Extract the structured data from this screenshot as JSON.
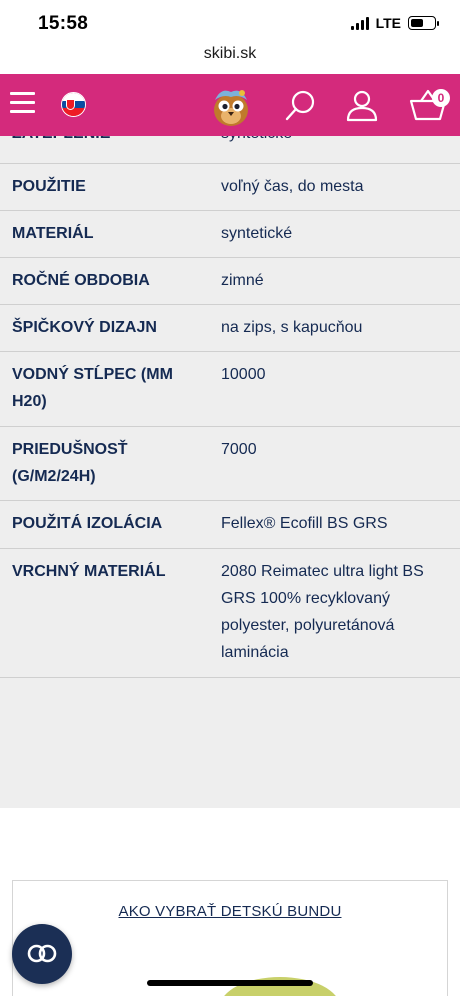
{
  "status_bar": {
    "time": "15:58",
    "network": "LTE",
    "battery_level": 0.55
  },
  "browser": {
    "url": "skibi.sk"
  },
  "header": {
    "cart_count": "0",
    "brand_color": "#d42a7c",
    "icons": [
      "menu-icon",
      "slovak-flag-icon",
      "mascot-logo",
      "search-icon",
      "account-icon",
      "cart-icon"
    ]
  },
  "specs": [
    {
      "key": "ZATEPLENIE",
      "value": "syntetické"
    },
    {
      "key": "POUŽITIE",
      "value": "voľný čas, do mesta"
    },
    {
      "key": "MATERIÁL",
      "value": "syntetické"
    },
    {
      "key": "ROČNÉ OBDOBIA",
      "value": "zimné"
    },
    {
      "key": "ŠPIČKOVÝ DIZAJN",
      "value": "na zips, s kapucňou"
    },
    {
      "key": "VODNÝ STĹPEC (MM H20)",
      "value": "10000"
    },
    {
      "key": "PRIEDUŠNOSŤ (G/M2/24H)",
      "value": "7000"
    },
    {
      "key": "POUŽITÁ IZOLÁCIA",
      "value": "Fellex® Ecofill BS GRS"
    },
    {
      "key": "VRCHNÝ MATERIÁL",
      "value": "2080 Reimatec ultra light BS GRS 100% recyklovaný polyester, polyuretánová laminácia"
    }
  ],
  "guide": {
    "link_text": "AKO VYBRAŤ DETSKÚ BUNDU"
  },
  "fab": {
    "icon": "link-icon",
    "color": "#1b2f55"
  }
}
